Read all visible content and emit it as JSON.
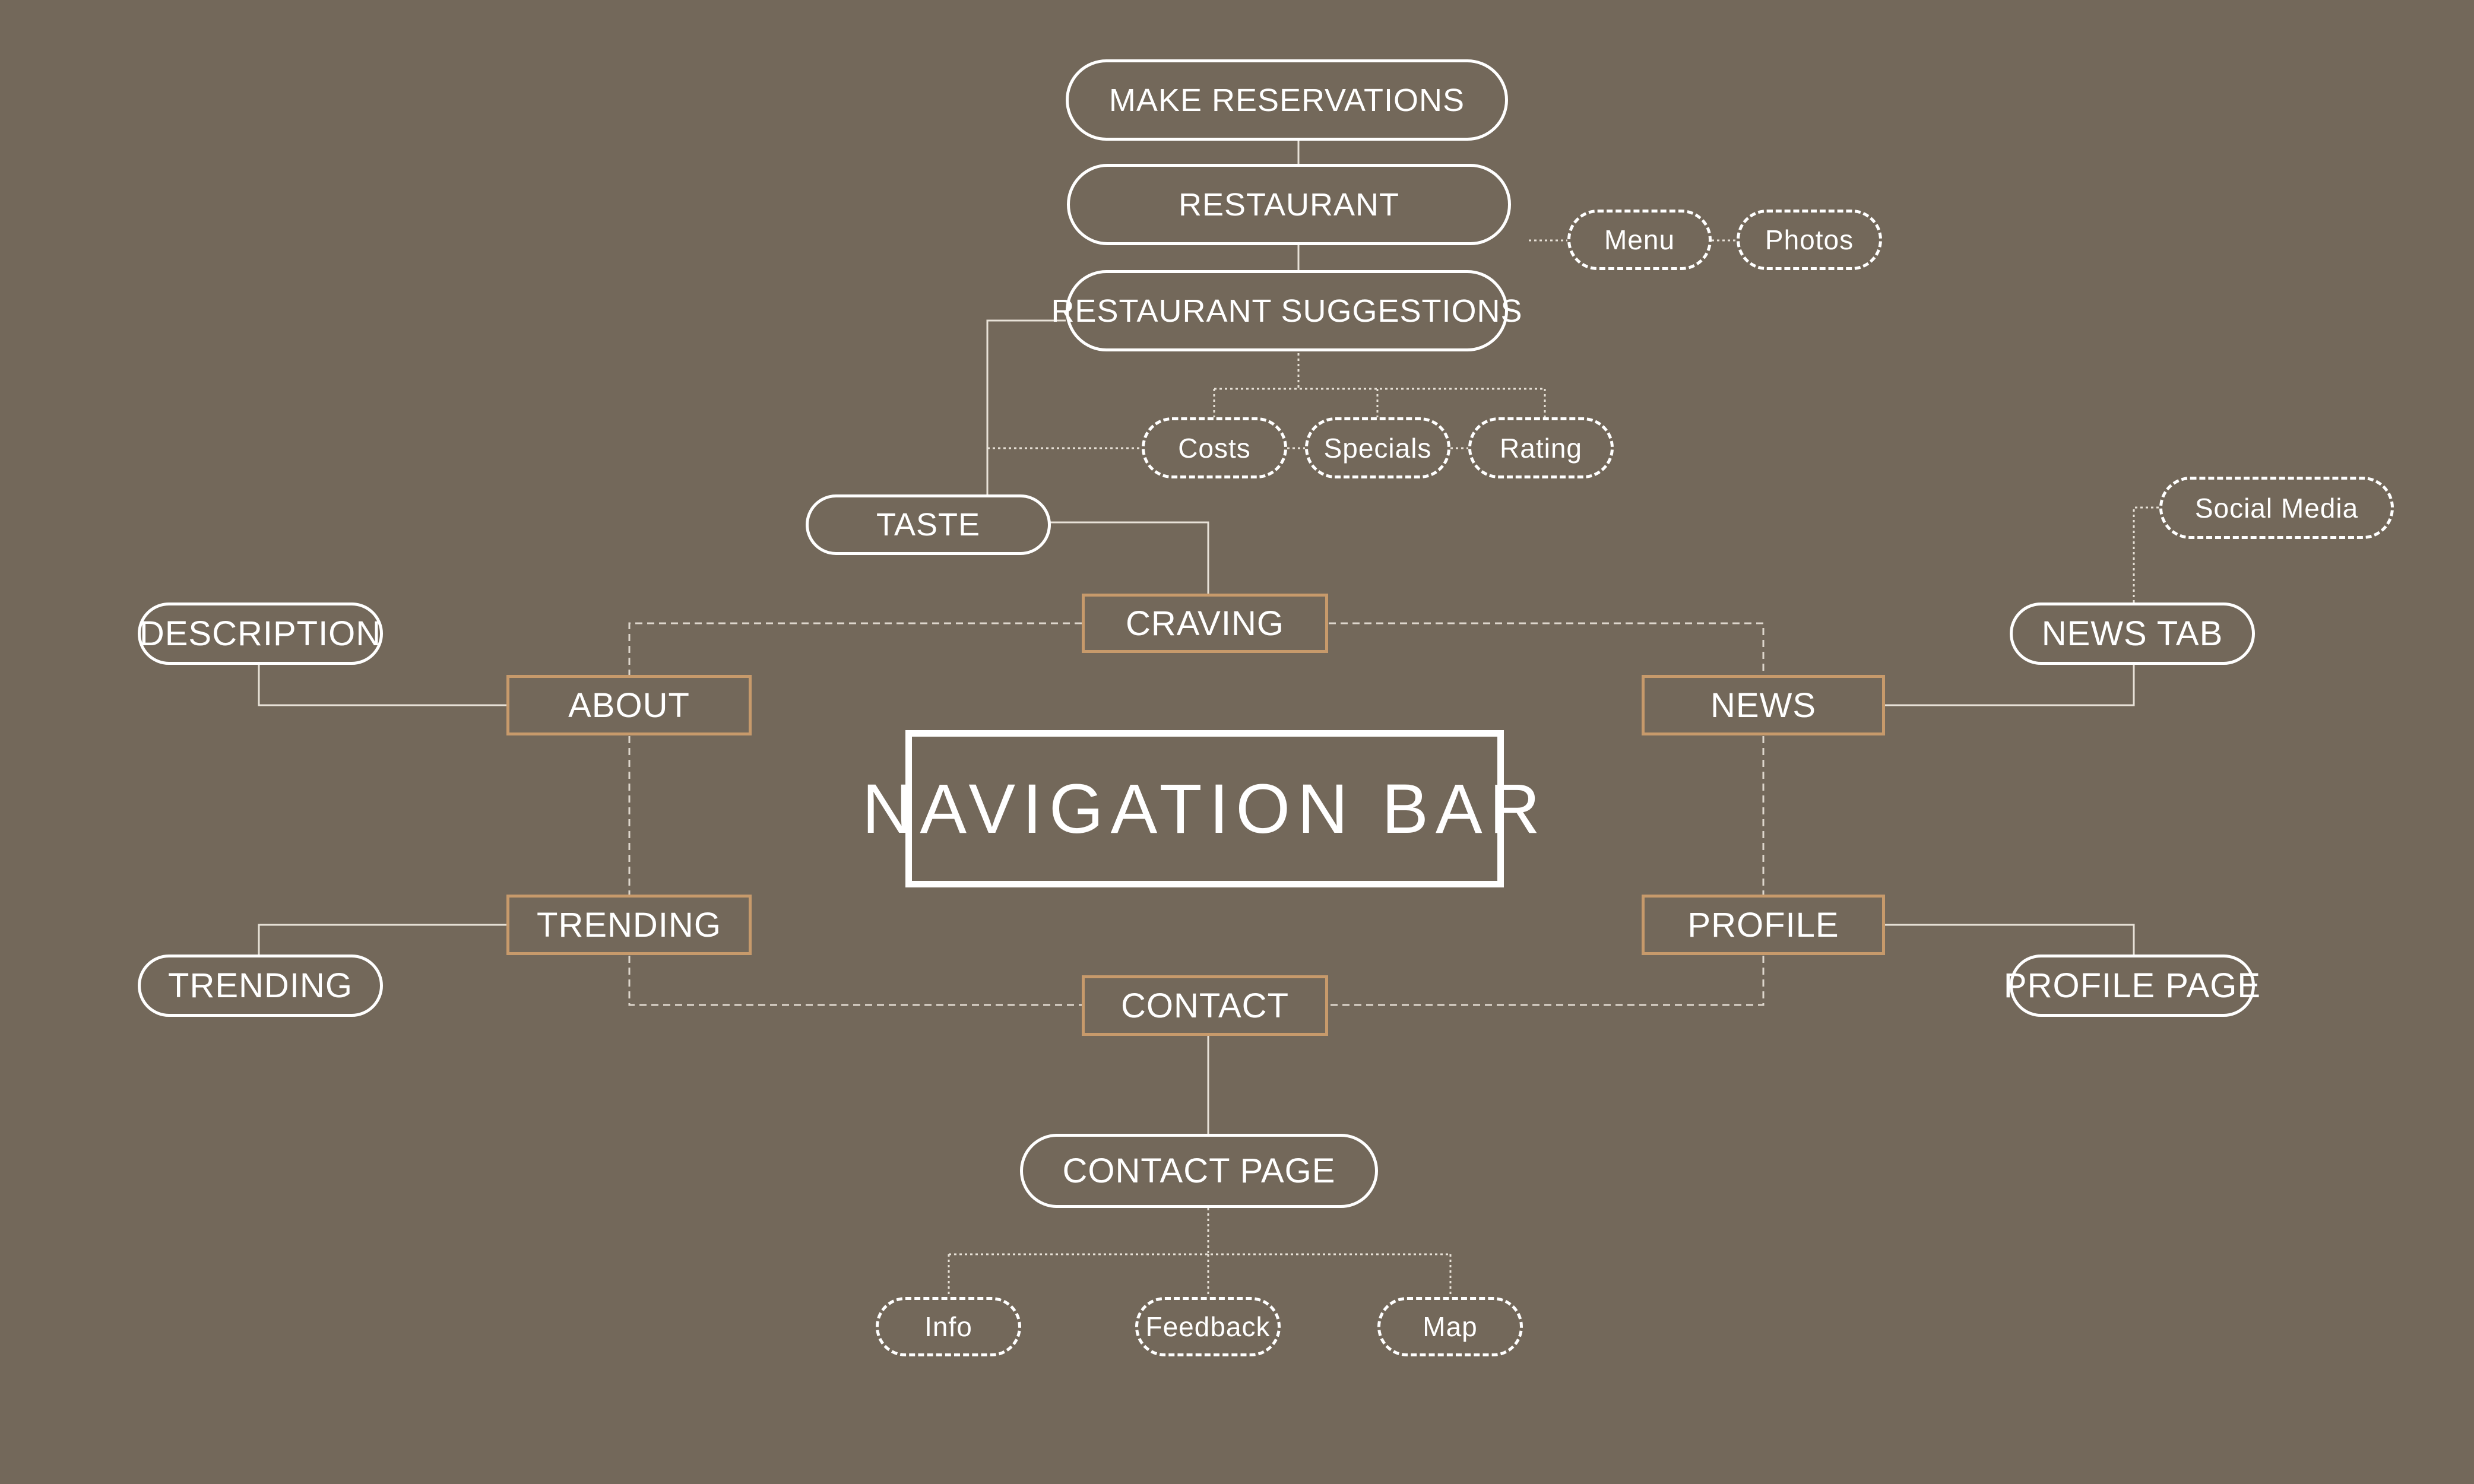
{
  "title": "NAVIGATION BAR",
  "primary": {
    "craving": "CRAVING",
    "about": "ABOUT",
    "news": "NEWS",
    "trending": "TRENDING",
    "profile": "PROFILE",
    "contact": "CONTACT"
  },
  "secondary": {
    "make_reservations": "MAKE RESERVATIONS",
    "restaurant": "RESTAURANT",
    "restaurant_suggestions": "RESTAURANT SUGGESTIONS",
    "taste": "TASTE",
    "description": "DESCRIPTION",
    "trending_page": "TRENDING",
    "news_tab": "NEWS TAB",
    "profile_page": "PROFILE PAGE",
    "contact_page": "CONTACT PAGE"
  },
  "details": {
    "menu": "Menu",
    "photos": "Photos",
    "costs": "Costs",
    "specials": "Specials",
    "rating": "Rating",
    "social_media": "Social Media",
    "info": "Info",
    "feedback": "Feedback",
    "map": "Map"
  },
  "colors": {
    "background": "#73685a",
    "accent": "#c79a6b",
    "foreground": "#ffffff"
  }
}
